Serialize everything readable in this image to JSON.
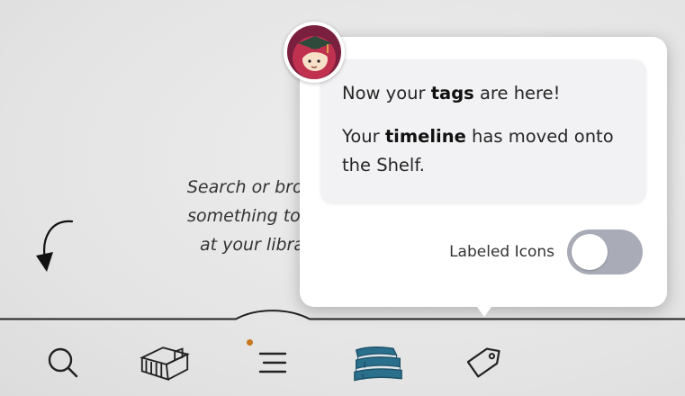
{
  "background_hint": {
    "lines": [
      "Search or brow",
      "something to b",
      "at your libra"
    ]
  },
  "popover": {
    "message_1": {
      "pre": "Now your ",
      "bold": "tags",
      "post": " are here!"
    },
    "message_2": {
      "pre": "Your ",
      "bold": "timeline",
      "post": " has moved onto the Shelf."
    },
    "toggle_label": "Labeled Icons",
    "toggle_state": "off"
  },
  "nav": {
    "items": [
      {
        "name": "search",
        "icon": "search-icon"
      },
      {
        "name": "libraries",
        "icon": "library-building-icon"
      },
      {
        "name": "menu",
        "icon": "menu-lines-icon",
        "has_notification": true
      },
      {
        "name": "shelf",
        "icon": "books-stack-icon",
        "active": true
      },
      {
        "name": "tags",
        "icon": "tag-icon"
      }
    ]
  },
  "colors": {
    "accent": "#2a6f8c",
    "notification_dot": "#c8771e",
    "avatar_bg": "#7a1f3d",
    "toggle_off": "#a9abb6"
  }
}
